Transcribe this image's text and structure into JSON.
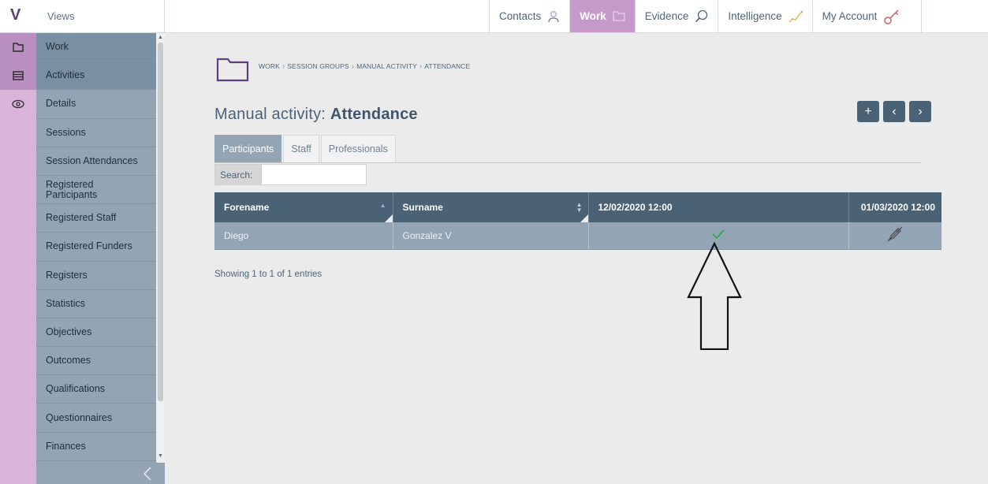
{
  "sidebar": {
    "logo": "V",
    "header_label": "Views",
    "items": [
      {
        "label": "Work",
        "icon": "folder-icon",
        "active": true
      },
      {
        "label": "Activities",
        "icon": "list-icon",
        "active": true
      },
      {
        "label": "Details",
        "icon": "eye-icon",
        "active": false
      },
      {
        "label": "Sessions",
        "icon": "",
        "active": false
      },
      {
        "label": "Session Attendances",
        "icon": "",
        "active": false
      },
      {
        "label": "Registered Participants",
        "icon": "",
        "active": false
      },
      {
        "label": "Registered Staff",
        "icon": "",
        "active": false
      },
      {
        "label": "Registered Funders",
        "icon": "",
        "active": false
      },
      {
        "label": "Registers",
        "icon": "",
        "active": false
      },
      {
        "label": "Statistics",
        "icon": "",
        "active": false
      },
      {
        "label": "Objectives",
        "icon": "",
        "active": false
      },
      {
        "label": "Outcomes",
        "icon": "",
        "active": false
      },
      {
        "label": "Qualifications",
        "icon": "",
        "active": false
      },
      {
        "label": "Questionnaires",
        "icon": "",
        "active": false
      },
      {
        "label": "Finances",
        "icon": "",
        "active": false
      }
    ],
    "collapse_icon": "chevron-left-icon"
  },
  "topnav": {
    "tabs": [
      {
        "label": "Contacts",
        "icon": "person-icon",
        "active": false
      },
      {
        "label": "Work",
        "icon": "folder-icon",
        "active": true
      },
      {
        "label": "Evidence",
        "icon": "magnifier-icon",
        "active": false
      },
      {
        "label": "Intelligence",
        "icon": "trend-icon",
        "active": false
      },
      {
        "label": "My Account",
        "icon": "key-icon",
        "active": false
      }
    ]
  },
  "breadcrumb": [
    "WORK",
    "SESSION GROUPS",
    "MANUAL ACTIVITY",
    "ATTENDANCE"
  ],
  "page": {
    "title_prefix": "Manual activity:",
    "title_main": "Attendance"
  },
  "actions": {
    "add": "+",
    "prev": "‹",
    "next": "›"
  },
  "subtabs": [
    {
      "label": "Participants",
      "active": true
    },
    {
      "label": "Staff",
      "active": false
    },
    {
      "label": "Professionals",
      "active": false
    }
  ],
  "search": {
    "label": "Search:",
    "value": ""
  },
  "table": {
    "columns": [
      "Forename",
      "Surname",
      "12/02/2020 12:00",
      "01/03/2020 12:00"
    ],
    "rows": [
      {
        "forename": "Diego",
        "surname": "Gonzalez V",
        "session1": "✓",
        "session2_icon": "pencil-off-icon"
      }
    ]
  },
  "footer": {
    "entries": "Showing 1 to 1 of 1 entries"
  },
  "colors": {
    "sidebar": "#93a5b4",
    "icon_strip": "#d9b3d9",
    "active_tab": "#c59acb",
    "header": "#4a6275",
    "check": "#2aa24a"
  }
}
